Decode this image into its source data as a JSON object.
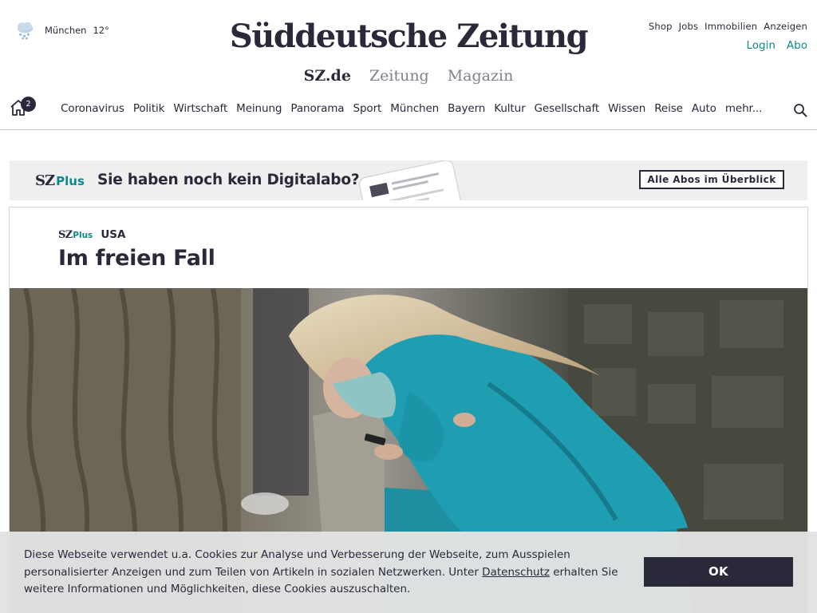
{
  "weather": {
    "icon": "rain-cloud-icon",
    "city": "München",
    "temperature": "12°"
  },
  "masthead": {
    "logo_text": "Süddeutsche Zeitung"
  },
  "meta_links": [
    "Shop",
    "Jobs",
    "Immobilien",
    "Anzeigen"
  ],
  "user_links": {
    "login": "Login",
    "abo": "Abo"
  },
  "editions": [
    "SZ.de",
    "Zeitung",
    "Magazin"
  ],
  "nav": {
    "home_badge": "2",
    "items": [
      "Coronavirus",
      "Politik",
      "Wirtschaft",
      "Meinung",
      "Panorama",
      "Sport",
      "München",
      "Bayern",
      "Kultur",
      "Gesellschaft",
      "Wissen",
      "Reise",
      "Auto",
      "mehr..."
    ]
  },
  "promo": {
    "brand_sz": "SZ",
    "brand_plus": "Plus",
    "headline": "Sie haben noch kein Digitalabo?",
    "cta": "Alle Abos im Überblick"
  },
  "article": {
    "brand_sz": "SZ",
    "brand_plus": "Plus",
    "kicker": "USA",
    "title": "Im freien Fall"
  },
  "cookie": {
    "text_before": "Diese Webseite verwendet u.a. Cookies zur Analyse und Verbesserung der Webseite, zum Ausspielen personalisierter Anzeigen und zum Teilen von Artikeln in sozialen Netzwerken. Unter ",
    "link": "Datenschutz",
    "text_after": " erhalten Sie weitere Informationen und Möglichkeiten, diese Cookies auszuschalten.",
    "ok_label": "OK"
  },
  "colors": {
    "text": "#29293a",
    "accent_teal": "#0e8a86",
    "banner_bg": "#efefef",
    "cookie_bg": "#e2e2e2"
  }
}
